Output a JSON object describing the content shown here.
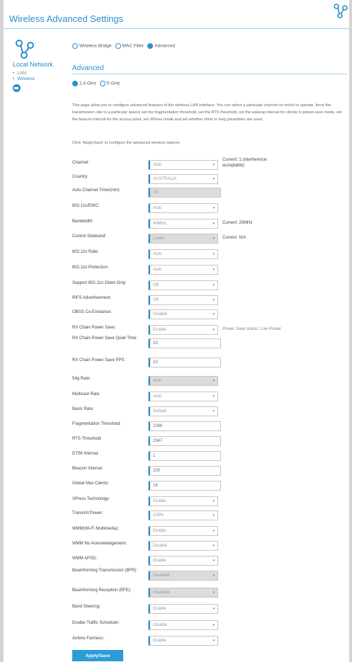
{
  "header": {
    "title": "Wireless Advanced Settings",
    "icon": "network-share-icon"
  },
  "sidebar": {
    "title": "Local Network",
    "items": [
      {
        "label": "LAN",
        "active": false
      },
      {
        "label": "Wireless",
        "active": true
      }
    ]
  },
  "mode_tabs": [
    {
      "label": "Wireless Bridge",
      "selected": false
    },
    {
      "label": "MAC Filter",
      "selected": false
    },
    {
      "label": "Advanced",
      "selected": true
    }
  ],
  "section_title": "Advanced",
  "bands": [
    {
      "label": "2.4 GHz",
      "selected": true
    },
    {
      "label": "5 GHz",
      "selected": false
    }
  ],
  "description": "This page allow you to configure advanced features of the wireless LAN interface. You can select a particular channel on which to operate, force the transmission rate to a particular speed, set the fragmentation threshold, set the RTS threshold, set the wakeup interval for clients in power-save mode, set the beacon interval for the access point, set XPress mode and set whether short or long preambles are used.",
  "apply_note": "Click 'Apply/Save' to configure the advanced wireless options.",
  "fields": [
    {
      "label": "Channel:",
      "value": "Auto",
      "kind": "select",
      "aux": "Current: 1 (interference: acceptable)"
    },
    {
      "label": "Country:",
      "value": "AUSTRALIA",
      "kind": "select"
    },
    {
      "label": "Auto Channel Timer(min)",
      "value": "15",
      "kind": "input-disabled"
    },
    {
      "label": "802.11n/EWC:",
      "value": "Auto",
      "kind": "select"
    },
    {
      "label": "Bandwidth:",
      "value": "40MHz",
      "kind": "select",
      "aux": "Current: 20MHz"
    },
    {
      "label": "Control Sideband:",
      "value": "Lower",
      "kind": "select-disabled",
      "aux": "Current: N/A"
    },
    {
      "label": "802.11n Rate:",
      "value": "Auto",
      "kind": "select"
    },
    {
      "label": "802.11n Protection:",
      "value": "Auto",
      "kind": "select"
    },
    {
      "label": "Support 802.11n Client Only:",
      "value": "Off",
      "kind": "select"
    },
    {
      "label": "RIFS Advertisement:",
      "value": "Off",
      "kind": "select"
    },
    {
      "label": "OBSS Co-Existance:",
      "value": "Disable",
      "kind": "select"
    },
    {
      "label": "RX Chain Power Save:",
      "value": "Enable",
      "kind": "select",
      "aux": "Power Save status: Low Power"
    },
    {
      "label": "RX Chain Power Save Quiet Time:",
      "value": "10",
      "kind": "input"
    },
    {
      "label": "RX Chain Power Save PPS:",
      "value": "10",
      "kind": "input"
    },
    {
      "label": "54g Rate:",
      "value": "Auto",
      "kind": "select-disabled"
    },
    {
      "label": "Multicast Rate:",
      "value": "Auto",
      "kind": "select"
    },
    {
      "label": "Basic Rate:",
      "value": "Default",
      "kind": "select"
    },
    {
      "label": "Fragmentation Threshold:",
      "value": "2346",
      "kind": "input"
    },
    {
      "label": "RTS Threshold:",
      "value": "2347",
      "kind": "input"
    },
    {
      "label": "DTIM Interval:",
      "value": "1",
      "kind": "input"
    },
    {
      "label": "Beacon Interval:",
      "value": "100",
      "kind": "input"
    },
    {
      "label": "Global Max Clients:",
      "value": "16",
      "kind": "input"
    },
    {
      "label": "XPress Technology:",
      "value": "Enable",
      "kind": "select"
    },
    {
      "label": "Transmit Power:",
      "value": "100%",
      "kind": "select"
    },
    {
      "label": "WMM(Wi-Fi Multimedia):",
      "value": "Enable",
      "kind": "select"
    },
    {
      "label": "WMM No Acknowledgement:",
      "value": "Disable",
      "kind": "select"
    },
    {
      "label": "WMM APSD:",
      "value": "Enable",
      "kind": "select"
    },
    {
      "label": "Beamforming Transmission (BFR):",
      "value": "Disabled",
      "kind": "select-disabled"
    },
    {
      "label": "Beamforming Reception (BFE):",
      "value": "Disabled",
      "kind": "select-disabled"
    },
    {
      "label": "Band Steering:",
      "value": "Enable",
      "kind": "select"
    },
    {
      "label": "Enable Traffic Scheduler:",
      "value": "Disable",
      "kind": "select"
    },
    {
      "label": "Airtime Fairness:",
      "value": "Enable",
      "kind": "select"
    }
  ],
  "apply_button": "Apply/Save",
  "colors": {
    "accent": "#2a8fce",
    "button": "#2d9bd7",
    "disabled": "#dcdcdc"
  }
}
